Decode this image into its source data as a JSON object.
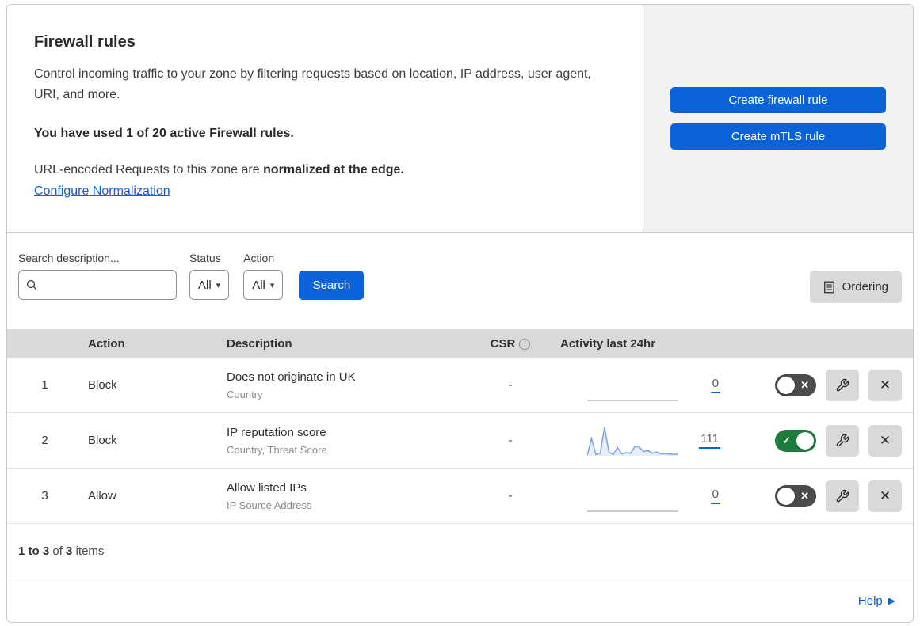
{
  "colors": {
    "primary": "#0c62d9",
    "panel_bg": "#f2f2f2",
    "table_header_bg": "#d9d9d9",
    "control_bg": "#d9d9d9",
    "toggle_on": "#1c7c3c",
    "toggle_off": "#4b4b4b",
    "sparkline": "#7aa3e6",
    "text_primary": "#333333",
    "text_secondary": "#8c8c8c"
  },
  "icons": {
    "dropdown_caret": "▾",
    "check": "✓",
    "cross": "✕",
    "info": "i",
    "help_arrow": "▶"
  },
  "header": {
    "title": "Firewall rules",
    "description": "Control incoming traffic to your zone by filtering requests based on location, IP address, user agent, URI, and more.",
    "usage": "You have used 1 of 20 active Firewall rules.",
    "normalization_prefix": "URL-encoded Requests to this zone are ",
    "normalization_bold": "normalized at the edge.",
    "normalization_link": "Configure Normalization",
    "create_firewall_button": "Create firewall rule",
    "create_mtls_button": "Create mTLS rule"
  },
  "filters": {
    "search_label": "Search description...",
    "search_placeholder": "",
    "search_value": "",
    "status_label": "Status",
    "status_value": "All",
    "action_label": "Action",
    "action_value": "All",
    "search_button": "Search",
    "ordering_button": "Ordering"
  },
  "table": {
    "columns": {
      "action": "Action",
      "description": "Description",
      "csr": "CSR",
      "activity": "Activity last 24hr"
    },
    "rows": [
      {
        "priority": "1",
        "action": "Block",
        "description": "Does not originate in UK",
        "fields": "Country",
        "csr": "-",
        "activity_count": "0",
        "enabled": false,
        "sparkline": []
      },
      {
        "priority": "2",
        "action": "Block",
        "description": "IP reputation score",
        "fields": "Country, Threat Score",
        "csr": "-",
        "activity_count": "111",
        "enabled": true,
        "sparkline": [
          2,
          55,
          4,
          8,
          90,
          12,
          4,
          26,
          6,
          10,
          8,
          30,
          28,
          13,
          17,
          8,
          12,
          6,
          7,
          5,
          5,
          5
        ]
      },
      {
        "priority": "3",
        "action": "Allow",
        "description": "Allow listed IPs",
        "fields": "IP Source Address",
        "csr": "-",
        "activity_count": "0",
        "enabled": false,
        "sparkline": []
      }
    ]
  },
  "footer": {
    "range": "1 to 3",
    "of_word": "of",
    "total": "3",
    "items_word": "items",
    "help_label": "Help"
  }
}
